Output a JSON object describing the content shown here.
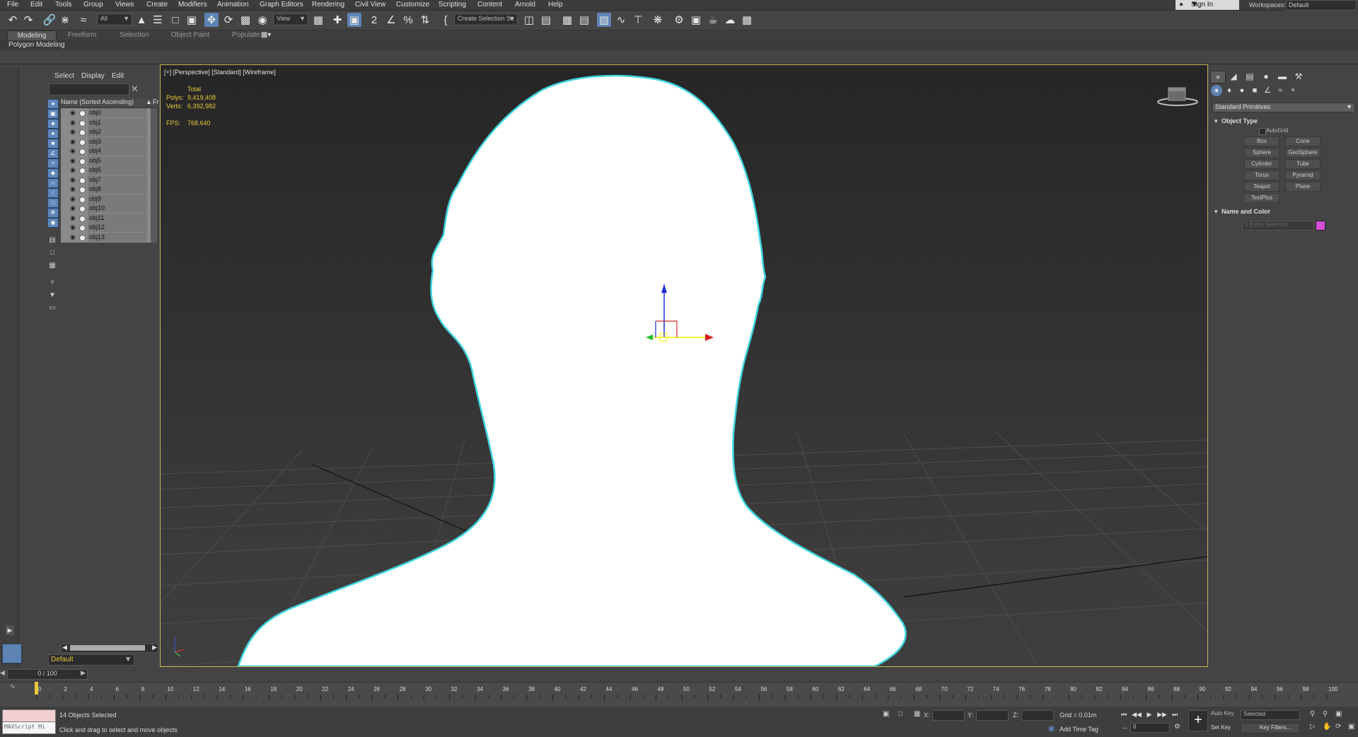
{
  "menu": [
    "File",
    "Edit",
    "Tools",
    "Group",
    "Views",
    "Create",
    "Modifiers",
    "Animation",
    "Graph Editors",
    "Rendering",
    "Civil View",
    "Customize",
    "Scripting",
    "Content",
    "Arnold",
    "Help"
  ],
  "account": {
    "sign_in": "Sign In",
    "workspaces_label": "Workspaces:",
    "workspace": "Default"
  },
  "toolbar": {
    "filter": "All",
    "ref_coord": "View",
    "selection_set": "Create Selection Se"
  },
  "ribbon": {
    "tabs": [
      "Modeling",
      "Freeform",
      "Selection",
      "Object Paint",
      "Populate"
    ],
    "active_tab": "Modeling",
    "subtitle": "Polygon Modeling"
  },
  "scene_explorer": {
    "menus": [
      "Select",
      "Display",
      "Edit"
    ],
    "column_name": "Name (Sorted Ascending)",
    "column_sort": "▲",
    "column_frozen": "Fr",
    "objects": [
      "obj0",
      "obj1",
      "obj2",
      "obj3",
      "obj4",
      "obj5",
      "obj6",
      "obj7",
      "obj8",
      "obj9",
      "obj10",
      "obj11",
      "obj12",
      "obj13"
    ],
    "layer": "Default"
  },
  "viewport": {
    "label": "[+] [Perspective] [Standard] [Wireframe]",
    "stats_total": "Total",
    "polys_label": "Polys:",
    "polys": "9,419,408",
    "verts_label": "Verts:",
    "verts": "6,392,982",
    "fps_label": "FPS:",
    "fps": "768.640",
    "axis_x": "x",
    "axis_z": "z"
  },
  "command_panel": {
    "category": "Standard Primitives",
    "object_type_title": "Object Type",
    "autogrid": "AutoGrid",
    "primitives": [
      "Box",
      "Cone",
      "Sphere",
      "GeoSphere",
      "Cylinder",
      "Tube",
      "Torus",
      "Pyramid",
      "Teapot",
      "Plane",
      "TextPlus"
    ],
    "name_color_title": "Name and Color",
    "name_placeholder": "0 Entity Selected",
    "object_color": "#d84ed6"
  },
  "timeline": {
    "slider": "0 / 100",
    "ticks": [
      "0",
      "2",
      "4",
      "6",
      "8",
      "10",
      "12",
      "14",
      "16",
      "18",
      "20",
      "22",
      "24",
      "26",
      "28",
      "30",
      "32",
      "34",
      "36",
      "38",
      "40",
      "42",
      "44",
      "46",
      "48",
      "50",
      "52",
      "54",
      "56",
      "58",
      "60",
      "62",
      "64",
      "66",
      "68",
      "70",
      "72",
      "74",
      "76",
      "78",
      "80",
      "82",
      "84",
      "86",
      "88",
      "90",
      "92",
      "94",
      "96",
      "98",
      "100"
    ]
  },
  "status": {
    "maxscript": "MAXScript Mi",
    "selection": "14 Objects Selected",
    "prompt": "Click and drag to select and move objects",
    "x_label": "X:",
    "y_label": "Y:",
    "z_label": "Z:",
    "grid": "Grid = 0.01m",
    "add_time_tag": "Add Time Tag",
    "auto_key": "Auto Key",
    "selected": "Selected",
    "set_key": "Set Key",
    "key_filters": "Key Filters...",
    "frame": "0"
  },
  "colors": {
    "accent": "#5d84b3",
    "highlight": "#e8c83a",
    "mesh_outline": "#3fd6e0"
  }
}
